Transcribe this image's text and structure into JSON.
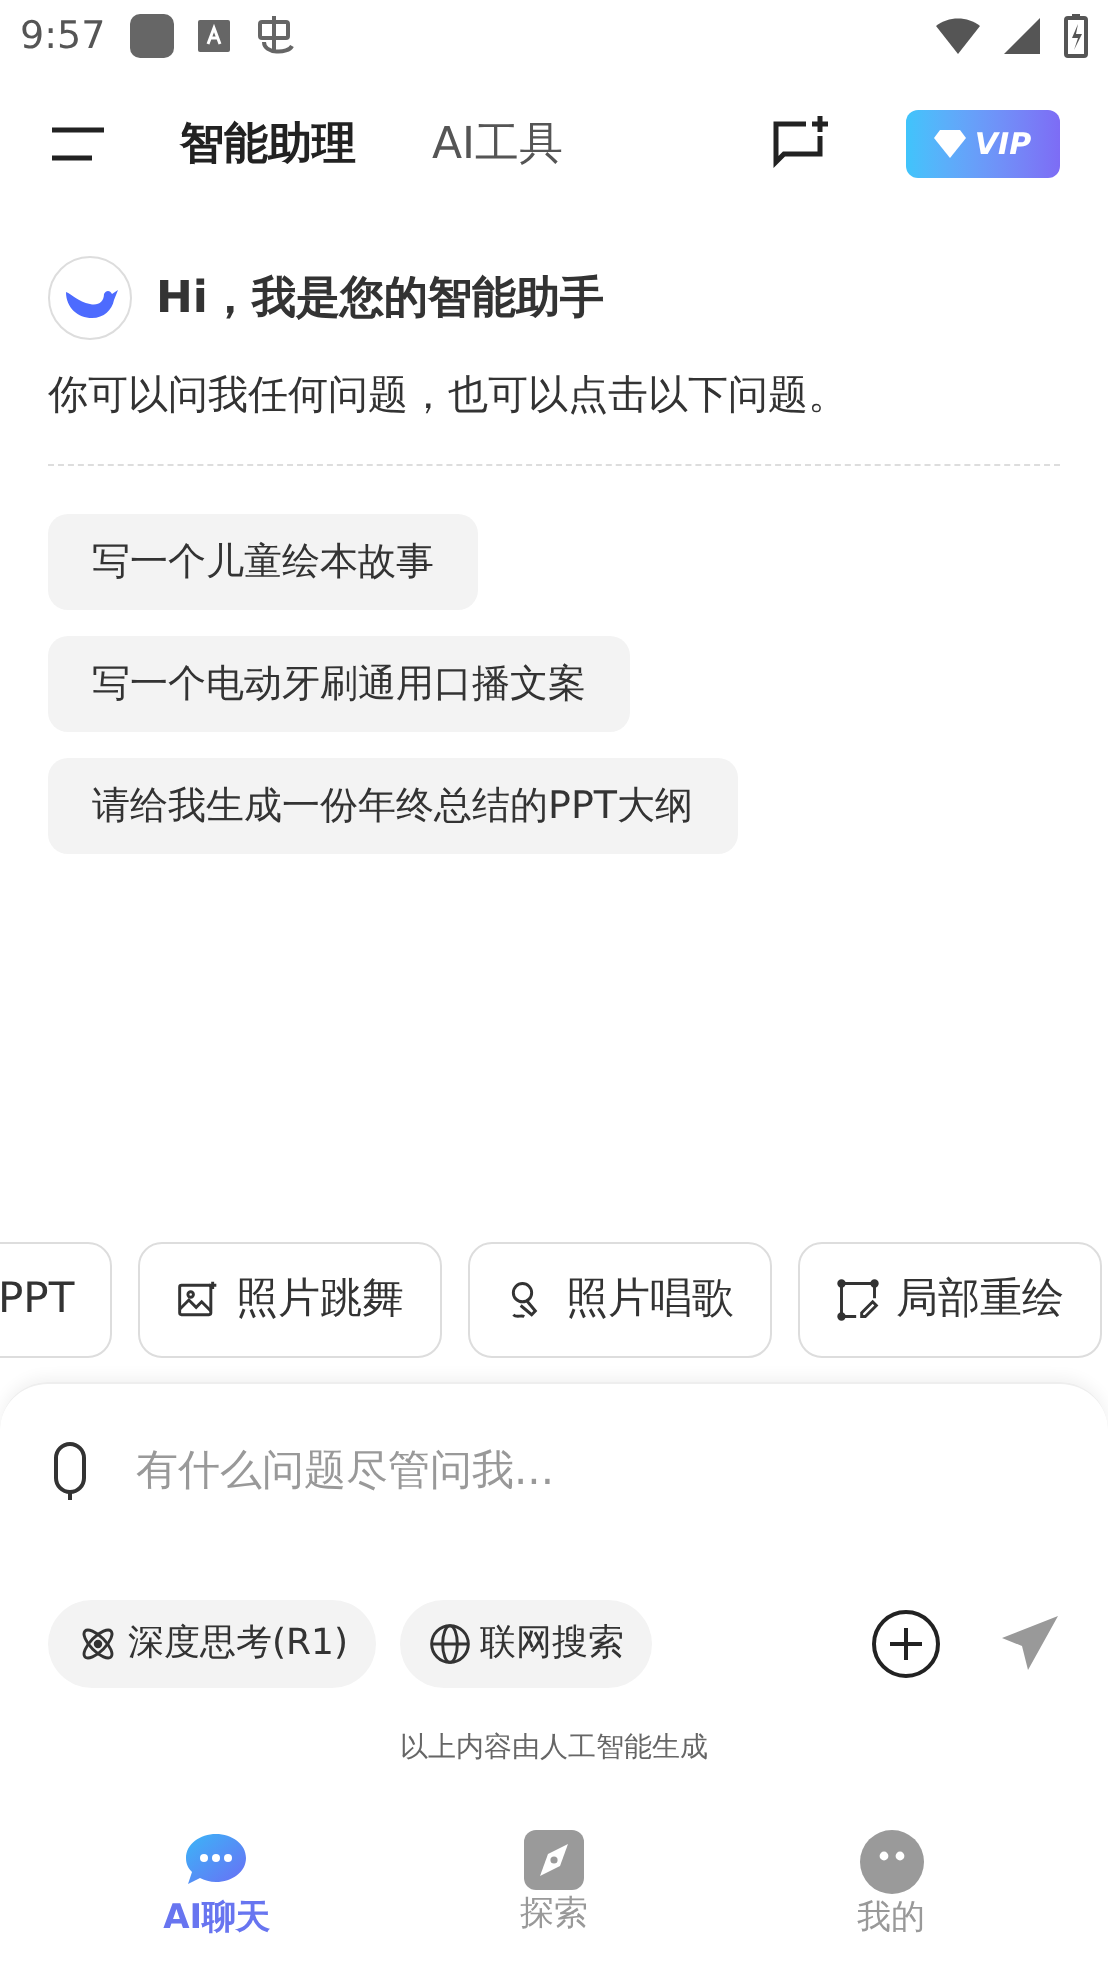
{
  "status_bar": {
    "time": "9:57"
  },
  "header": {
    "tabs": [
      {
        "label": "智能助理",
        "selected": true
      },
      {
        "label": "AI工具",
        "selected": false
      }
    ],
    "vip": "VIP"
  },
  "greeting": {
    "title": "Hi，我是您的智能助手",
    "subtitle": "你可以问我任何问题，也可以点击以下问题。"
  },
  "suggestions": [
    "写一个儿童绘本故事",
    "写一个电动牙刷通用口播文案",
    "请给我生成一份年终总结的PPT大纲"
  ],
  "tools": [
    {
      "label": "PPT",
      "kind": "none"
    },
    {
      "label": "照片跳舞",
      "kind": "image"
    },
    {
      "label": "照片唱歌",
      "kind": "mic"
    },
    {
      "label": "局部重绘",
      "kind": "edit"
    }
  ],
  "input": {
    "placeholder": "有什么问题尽管问我...",
    "options": [
      {
        "label": "深度思考(R1)",
        "kind": "atom"
      },
      {
        "label": "联网搜索",
        "kind": "globe"
      }
    ]
  },
  "disclaimer": "以上内容由人工智能生成",
  "nav": [
    {
      "label": "AI聊天",
      "kind": "chat",
      "selected": true
    },
    {
      "label": "探索",
      "kind": "compass",
      "selected": false
    },
    {
      "label": "我的",
      "kind": "face",
      "selected": false
    }
  ]
}
